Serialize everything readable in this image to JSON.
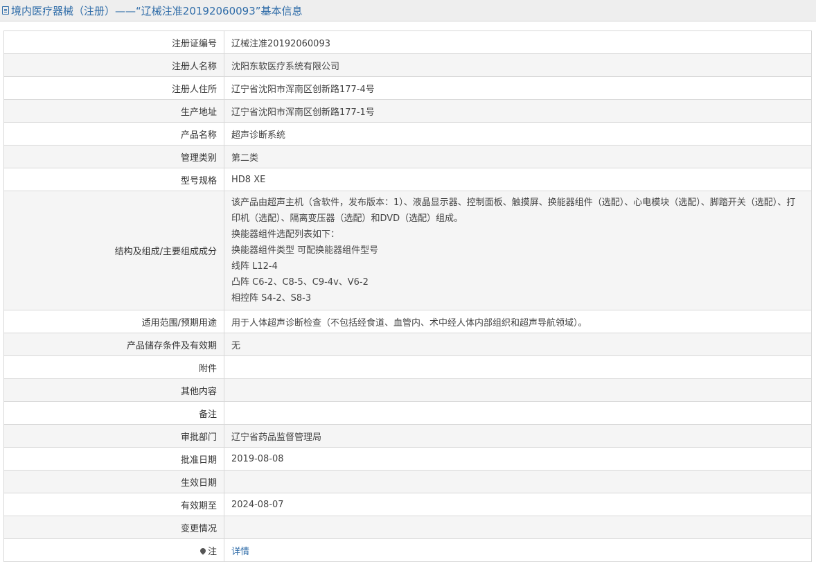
{
  "header": {
    "icon": "document-icon",
    "title": "境内医疗器械（注册）——“辽械注准20192060093”基本信息"
  },
  "rows": [
    {
      "label": "注册证编号",
      "value": "辽械注准20192060093"
    },
    {
      "label": "注册人名称",
      "value": "沈阳东软医疗系统有限公司"
    },
    {
      "label": "注册人住所",
      "value": "辽宁省沈阳市浑南区创新路177-4号"
    },
    {
      "label": "生产地址",
      "value": "辽宁省沈阳市浑南区创新路177-1号"
    },
    {
      "label": "产品名称",
      "value": "超声诊断系统"
    },
    {
      "label": "管理类别",
      "value": "第二类"
    },
    {
      "label": "型号规格",
      "value": "HD8 XE"
    },
    {
      "label": "结构及组成/主要组成成分",
      "lines": [
        "该产品由超声主机（含软件，发布版本：1）、液晶显示器、控制面板、触摸屏、换能器组件（选配）、心电模块（选配）、脚踏开关（选配）、打印机（选配）、隔离变压器（选配）和DVD（选配）组成。",
        "换能器组件选配列表如下：",
        "换能器组件类型 可配换能器组件型号",
        "线阵 L12-4",
        "凸阵 C6-2、C8-5、C9-4v、V6-2",
        "相控阵 S4-2、S8-3"
      ]
    },
    {
      "label": "适用范围/预期用途",
      "value": "用于人体超声诊断检查（不包括经食道、血管内、术中经人体内部组织和超声导航领域）。"
    },
    {
      "label": "产品储存条件及有效期",
      "value": "无"
    },
    {
      "label": "附件",
      "value": ""
    },
    {
      "label": "其他内容",
      "value": ""
    },
    {
      "label": "备注",
      "value": ""
    },
    {
      "label": "审批部门",
      "value": "辽宁省药品监督管理局"
    },
    {
      "label": "批准日期",
      "value": "2019-08-08"
    },
    {
      "label": "生效日期",
      "value": ""
    },
    {
      "label": "有效期至",
      "value": "2024-08-07"
    },
    {
      "label": "变更情况",
      "value": ""
    },
    {
      "label": "注",
      "icon": "pin-icon",
      "link": "详情"
    }
  ]
}
